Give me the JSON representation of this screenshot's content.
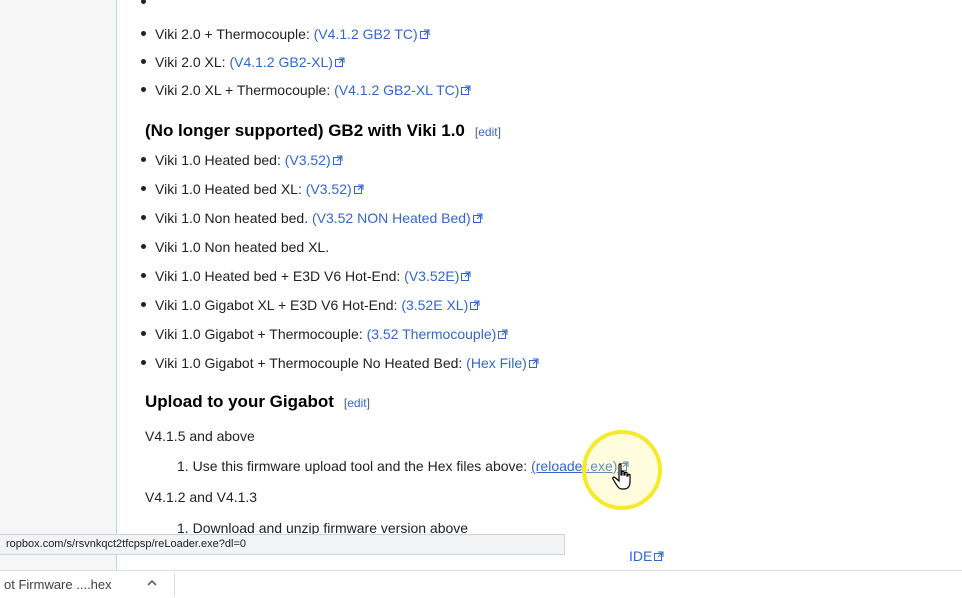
{
  "list_top": [
    {
      "text": "Viki 2.0 + Thermocouple: ",
      "link": "(V4.1.2 GB2 TC)"
    },
    {
      "text": "Viki 2.0 XL: ",
      "link": "(V4.1.2 GB2-XL)"
    },
    {
      "text": "Viki 2.0 XL + Thermocouple: ",
      "link": "(V4.1.2 GB2-XL TC)"
    }
  ],
  "section_viki1": {
    "heading": "(No longer supported) GB2 with Viki 1.0",
    "edit": "edit",
    "items": [
      {
        "text": "Viki 1.0 Heated bed: ",
        "link": "(V3.52)"
      },
      {
        "text": "Viki 1.0 Heated bed XL: ",
        "link": "(V3.52)"
      },
      {
        "text": "Viki 1.0 Non heated bed. ",
        "link": "(V3.52 NON Heated Bed)"
      },
      {
        "text": "Viki 1.0 Non heated bed XL.",
        "link": ""
      },
      {
        "text": "Viki 1.0 Heated bed + E3D V6 Hot-End: ",
        "link": "(V3.52E)"
      },
      {
        "text": "Viki 1.0 Gigabot XL + E3D V6 Hot-End: ",
        "link": "(3.52E XL)"
      },
      {
        "text": "Viki 1.0 Gigabot + Thermocouple: ",
        "link": "(3.52 Thermocouple)"
      },
      {
        "text": "Viki 1.0 Gigabot + Thermocouple No Heated Bed: ",
        "link": "(Hex File)"
      }
    ]
  },
  "section_upload": {
    "heading": "Upload to your Gigabot",
    "edit": "edit",
    "v415_label": "V4.1.5 and above",
    "step1_num": "1.",
    "step1_text": "Use this firmware upload tool and the Hex files above: ",
    "step1_link": "(reloader.exe)",
    "v412_label": "V4.1.2 and V4.1.3",
    "step2_num": "1.",
    "step2_text": "Download and unzip firmware version above",
    "partial_link": "IDE"
  },
  "status_url": "ropbox.com/s/rsvnkqct2tfcpsp/reLoader.exe?dl=0",
  "download": {
    "filename": "ot Firmware ....hex"
  },
  "colors": {
    "link": "#3366cc",
    "highlight": "#f4ea2a"
  }
}
